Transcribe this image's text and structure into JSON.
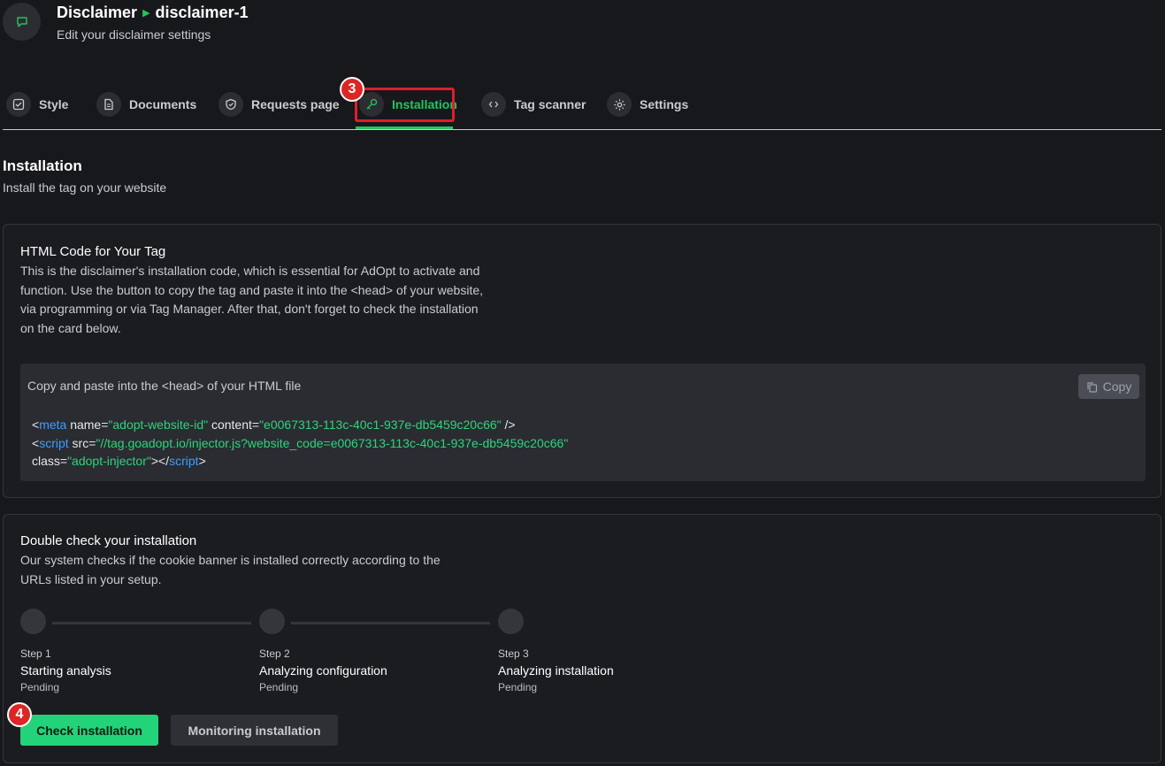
{
  "header": {
    "breadcrumb_parent": "Disclaimer",
    "breadcrumb_child": "disclaimer-1",
    "subtitle": "Edit your disclaimer settings",
    "icon": "chat-bubble-icon"
  },
  "tabs": [
    {
      "label": "Style",
      "icon": "checkbox-icon"
    },
    {
      "label": "Documents",
      "icon": "document-icon"
    },
    {
      "label": "Requests page",
      "icon": "shield-icon"
    },
    {
      "label": "Installation",
      "icon": "key-icon",
      "active": true
    },
    {
      "label": "Tag scanner",
      "icon": "code-icon"
    },
    {
      "label": "Settings",
      "icon": "gear-icon"
    }
  ],
  "annotations": {
    "badge_tab": "3",
    "badge_button": "4"
  },
  "section": {
    "title": "Installation",
    "subtitle": "Install the tag on your website"
  },
  "html_card": {
    "title": "HTML Code for Your Tag",
    "description": "This is the disclaimer's installation code, which is essential for AdOpt to activate and function. Use the button to copy the tag and paste it into the <head> of your website, via programming or via Tag Manager. After that, don't forget to check the installation on the card below.",
    "code_hint": "Copy and paste into the <head> of your HTML file",
    "copy_label": "Copy",
    "code": {
      "line1_open": "<",
      "line1_tag": "meta",
      "line1_attr1": " name=",
      "line1_val1": "\"adopt-website-id\"",
      "line1_attr2": " content=",
      "line1_val2": "\"e0067313-113c-40c1-937e-db5459c20c66\"",
      "line1_close": " />",
      "line2_open": "<",
      "line2_tag": "script",
      "line2_attr": " src=",
      "line2_val": "\"//tag.goadopt.io/injector.js?website_code=e0067313-113c-40c1-937e-db5459c20c66\"",
      "line3_attr": "class=",
      "line3_val": "\"adopt-injector\"",
      "line3_mid": "></",
      "line3_tag": "script",
      "line3_close": ">"
    }
  },
  "check_card": {
    "title": "Double check your installation",
    "description": "Our system checks if the cookie banner is installed correctly according to the URLs listed in your setup.",
    "steps": [
      {
        "label": "Step 1",
        "name": "Starting analysis",
        "status": "Pending"
      },
      {
        "label": "Step 2",
        "name": "Analyzing configuration",
        "status": "Pending"
      },
      {
        "label": "Step 3",
        "name": "Analyzing installation",
        "status": "Pending"
      }
    ],
    "primary_button": "Check installation",
    "secondary_button": "Monitoring installation"
  },
  "colors": {
    "accent": "#22c55e",
    "highlight": "#e11d2a",
    "tag": "#3b9eff",
    "string": "#2ed47a"
  }
}
